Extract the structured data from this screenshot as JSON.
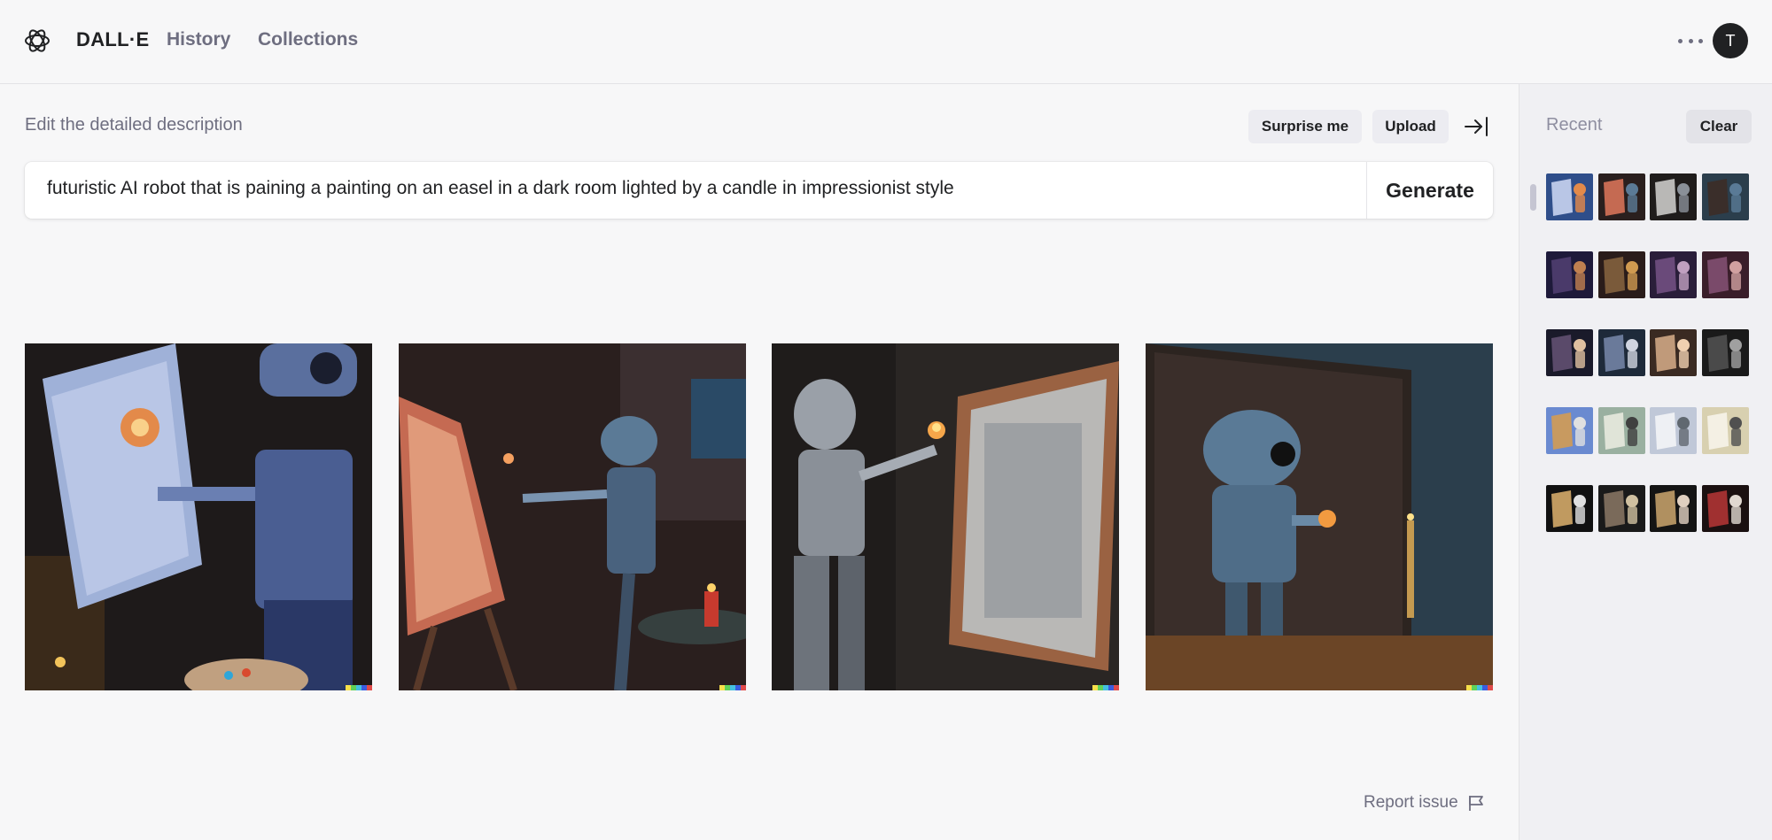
{
  "header": {
    "brand": "DALL·E",
    "nav": {
      "history": "History",
      "collections": "Collections"
    },
    "avatar_initial": "T"
  },
  "editor": {
    "label": "Edit the detailed description",
    "surprise_label": "Surprise me",
    "upload_label": "Upload",
    "prompt": "futuristic AI robot that is paining a painting on an easel in a dark room lighted by a candle in impressionist style",
    "generate_label": "Generate"
  },
  "report_label": "Report issue",
  "sidebar": {
    "recent_label": "Recent",
    "clear_label": "Clear"
  },
  "colors": {
    "accent_text": "#202123",
    "muted_text": "#6e6e80",
    "background": "#f7f7f8",
    "sidebar_bg": "#f0f0f3"
  }
}
